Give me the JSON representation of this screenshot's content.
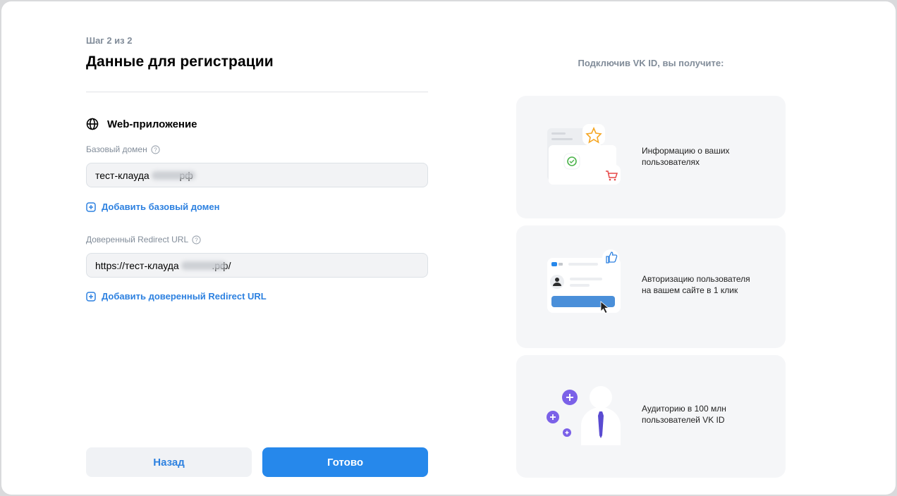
{
  "step": "Шаг 2 из 2",
  "title": "Данные для регистрации",
  "section": {
    "label": "Web-приложение",
    "icon": "globe-icon"
  },
  "base_domain": {
    "label": "Базовый домен",
    "value": "тест-клауда           рф",
    "add_label": "Добавить базовый домен"
  },
  "redirect_url": {
    "label": "Доверенный Redirect URL",
    "value": "https://тест-клауда            .рф/",
    "add_label": "Добавить доверенный Redirect URL"
  },
  "buttons": {
    "back": "Назад",
    "done": "Готово"
  },
  "benefits": {
    "title": "Подключив VK ID, вы получите:",
    "items": [
      {
        "line1": "Информацию о ваших",
        "line2": "пользователях"
      },
      {
        "line1": "Авторизацию пользователя",
        "line2": "на вашем сайте в 1 клик"
      },
      {
        "line1": "Аудиторию в 100 млн",
        "line2": "пользователей VK ID"
      }
    ]
  },
  "colors": {
    "accent": "#2688eb",
    "link": "#2d81e0",
    "muted": "#818c99",
    "purple": "#7b61e8"
  }
}
